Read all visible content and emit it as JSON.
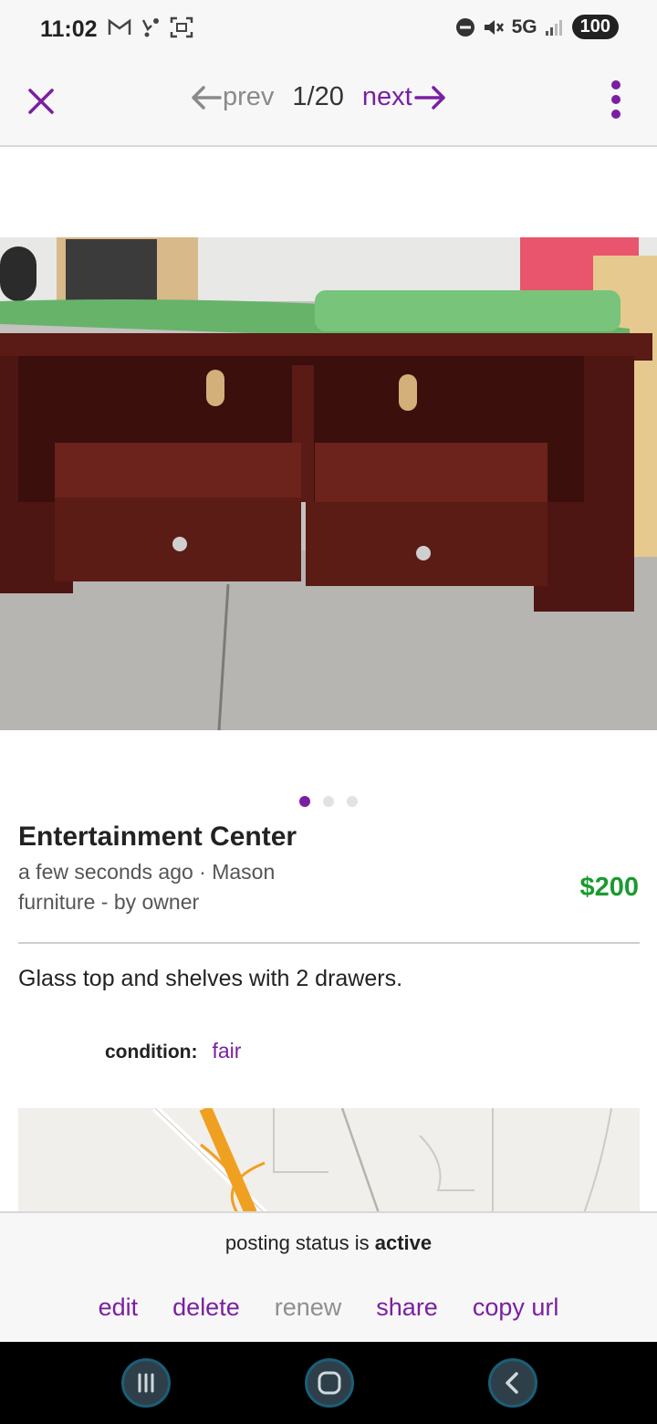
{
  "status_bar": {
    "time": "11:02",
    "network": "5G",
    "battery": "100",
    "icons_left": [
      "gmail-icon",
      "voicemail-icon",
      "screenshot-icon"
    ],
    "icons_right": [
      "dnd-icon",
      "mute-icon",
      "signal-icon"
    ]
  },
  "nav": {
    "prev_label": "prev",
    "counter": "1/20",
    "next_label": "next"
  },
  "gallery": {
    "dot_count": 3,
    "active_index": 0
  },
  "listing": {
    "title": "Entertainment Center",
    "posted": "a few seconds ago · Mason",
    "category": "furniture - by owner",
    "price": "$200",
    "description": "Glass top and shelves with 2 drawers.",
    "condition_label": "condition:",
    "condition_value": "fair"
  },
  "footer": {
    "status_prefix": "posting status is",
    "status_value": "active",
    "actions": {
      "edit": "edit",
      "delete": "delete",
      "renew": "renew",
      "share": "share",
      "copy_url": "copy url"
    }
  },
  "colors": {
    "accent": "#7a1fa2",
    "price": "#1b9a2f",
    "disabled": "#8f8f8f"
  }
}
